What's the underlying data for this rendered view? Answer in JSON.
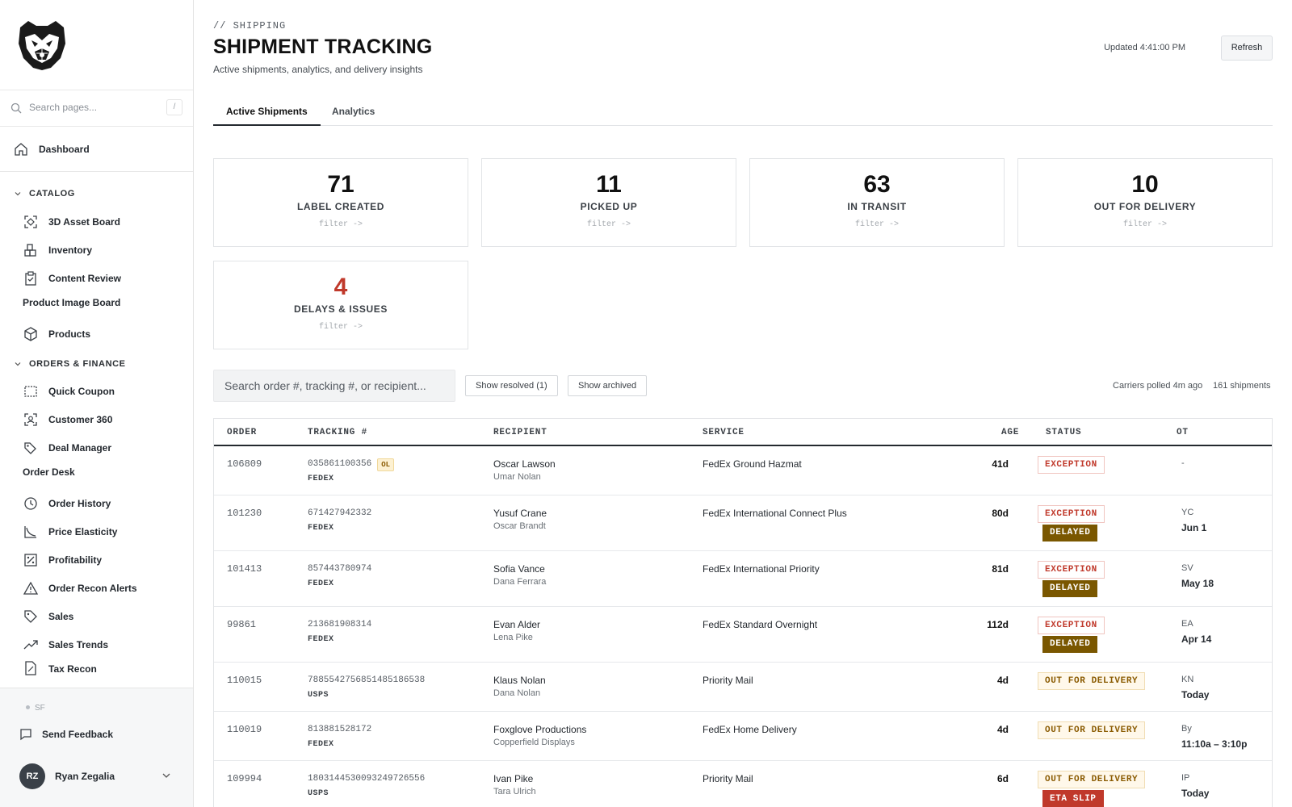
{
  "sidebar": {
    "search_placeholder": "Search pages...",
    "search_shortcut": "/",
    "dashboard": "Dashboard",
    "catalog_header": "CATALOG",
    "catalog_items": [
      "3D Asset Board",
      "Inventory",
      "Content Review"
    ],
    "product_image_board": "Product Image Board",
    "products": "Products",
    "orders_header": "ORDERS & FINANCE",
    "orders_items_a": [
      "Quick Coupon",
      "Customer 360",
      "Deal Manager"
    ],
    "order_desk": "Order Desk",
    "orders_items_b": [
      "Order History",
      "Price Elasticity",
      "Profitability",
      "Order Recon Alerts",
      "Sales",
      "Sales Trends",
      "Tax Recon"
    ],
    "sf": "SF",
    "send_feedback": "Send Feedback",
    "user_initials": "RZ",
    "user_name": "Ryan Zegalia"
  },
  "header": {
    "breadcrumb": "// SHIPPING",
    "title": "SHIPMENT TRACKING",
    "subtitle": "Active shipments, analytics, and delivery insights",
    "updated": "Updated 4:41:00 PM",
    "refresh": "Refresh"
  },
  "tabs": [
    "Active Shipments",
    "Analytics"
  ],
  "cards": [
    {
      "value": "71",
      "label": "LABEL CREATED",
      "filter": "filter ->"
    },
    {
      "value": "11",
      "label": "PICKED UP",
      "filter": "filter ->"
    },
    {
      "value": "63",
      "label": "IN TRANSIT",
      "filter": "filter ->"
    },
    {
      "value": "10",
      "label": "OUT FOR DELIVERY",
      "filter": "filter ->"
    },
    {
      "value": "4",
      "label": "DELAYS & ISSUES",
      "filter": "filter ->"
    }
  ],
  "toolbar": {
    "search_placeholder": "Search order #, tracking #, or recipient...",
    "show_resolved": "Show resolved (1)",
    "show_archived": "Show archived",
    "carriers_polled": "Carriers polled 4m ago",
    "shipment_count": "161 shipments"
  },
  "table": {
    "headers": [
      "ORDER",
      "TRACKING #",
      "RECIPIENT",
      "SERVICE",
      "AGE",
      "STATUS",
      "OT"
    ],
    "rows": [
      {
        "order": "106809",
        "tracking": "035861100356",
        "tag": "OL",
        "carrier": "FEDEX",
        "recipient": "Oscar Lawson",
        "recipient_sub": "Umar Nolan",
        "service": "FedEx Ground Hazmat",
        "age": "41d",
        "status": [
          "EXCEPTION"
        ],
        "ot1": "-",
        "ot2": ""
      },
      {
        "order": "101230",
        "tracking": "671427942332",
        "tag": "",
        "carrier": "FEDEX",
        "recipient": "Yusuf Crane",
        "recipient_sub": "Oscar Brandt",
        "service": "FedEx International Connect Plus",
        "age": "80d",
        "status": [
          "EXCEPTION",
          "DELAYED"
        ],
        "ot1": "YC",
        "ot2": "Jun 1"
      },
      {
        "order": "101413",
        "tracking": "857443780974",
        "tag": "",
        "carrier": "FEDEX",
        "recipient": "Sofia Vance",
        "recipient_sub": "Dana Ferrara",
        "service": "FedEx International Priority",
        "age": "81d",
        "status": [
          "EXCEPTION",
          "DELAYED"
        ],
        "ot1": "SV",
        "ot2": "May 18"
      },
      {
        "order": "99861",
        "tracking": "213681908314",
        "tag": "",
        "carrier": "FEDEX",
        "recipient": "Evan Alder",
        "recipient_sub": "Lena Pike",
        "service": "FedEx Standard Overnight",
        "age": "112d",
        "status": [
          "EXCEPTION",
          "DELAYED"
        ],
        "ot1": "EA",
        "ot2": "Apr 14"
      },
      {
        "order": "110015",
        "tracking": "7885542756851485186538",
        "tag": "",
        "carrier": "USPS",
        "recipient": "Klaus Nolan",
        "recipient_sub": "Dana Nolan",
        "service": "Priority Mail",
        "age": "4d",
        "status": [
          "OUT FOR DELIVERY"
        ],
        "ot1": "KN",
        "ot2": "Today"
      },
      {
        "order": "110019",
        "tracking": "813881528172",
        "tag": "",
        "carrier": "FEDEX",
        "recipient": "Foxglove Productions",
        "recipient_sub": "Copperfield Displays",
        "service": "FedEx Home Delivery",
        "age": "4d",
        "status": [
          "OUT FOR DELIVERY"
        ],
        "ot1": "By",
        "ot2": "11:10a – 3:10p"
      },
      {
        "order": "109994",
        "tracking": "1803144530093249726556",
        "tag": "",
        "carrier": "USPS",
        "recipient": "Ivan Pike",
        "recipient_sub": "Tara Ulrich",
        "service": "Priority Mail",
        "age": "6d",
        "status": [
          "OUT FOR DELIVERY",
          "ETA SLIP"
        ],
        "ot1": "IP",
        "ot2": "Today"
      }
    ]
  },
  "colors": {
    "accent_red": "#c0392b",
    "delayed": "#7a5700",
    "ofd": "#8a5a00"
  }
}
